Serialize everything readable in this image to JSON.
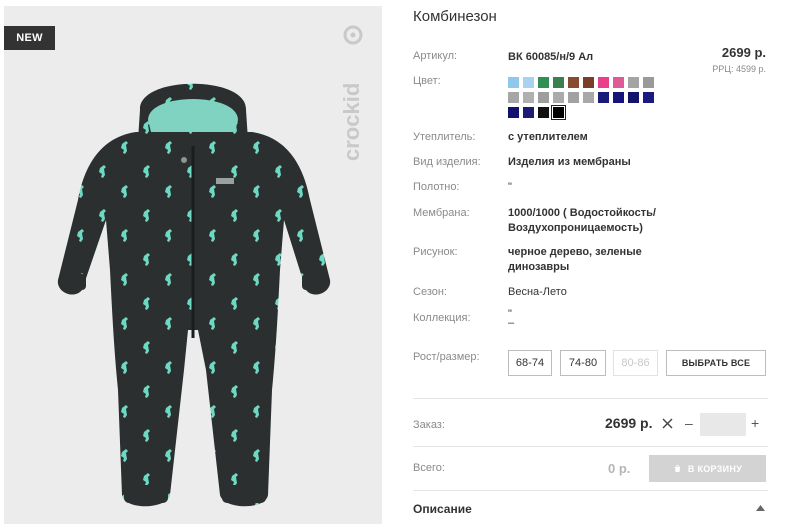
{
  "gallery": {
    "badge": "NEW",
    "brand": "crockid"
  },
  "product": {
    "title": "Комбинезон",
    "price": "2699 р.",
    "rrp": "РРЦ: 4599 р."
  },
  "specs": {
    "article_label": "Артикул:",
    "article_value": "ВК 60085/н/9 Ал",
    "color_label": "Цвет:",
    "insulation_label": "Утеплитель:",
    "insulation_value": "с утеплителем",
    "type_label": "Вид изделия:",
    "type_value": "Изделия из мембраны",
    "fabric_label": "Полотно:",
    "fabric_value": "\"",
    "membrane_label": "Мембрана:",
    "membrane_value": "1000/1000 ( Водостойкость/ Воздухопроницаемость)",
    "pattern_label": "Рисунок:",
    "pattern_value": "черное дерево, зеленые динозавры",
    "season_label": "Сезон:",
    "season_value": "Весна-Лето",
    "collection_label": "Коллекция:",
    "collection_value_1": "\"",
    "collection_value_2": "–"
  },
  "colors": [
    "#8ec8ef",
    "#a9d2f0",
    "#2f8f55",
    "#3a7f4e",
    "#8a4a2c",
    "#7a3d27",
    "#ea3e8c",
    "#e05a98",
    "#a4a4a4",
    "#9a9a9a",
    "#a6a6a6",
    "#b0b0b0",
    "#9d9d9d",
    "#ababab",
    "#a1a1a1",
    "#a8a8a8",
    "#1a1a78",
    "#14147a",
    "#111468",
    "#1a1a80",
    "#12126e",
    "#1c1c74",
    "#111111",
    "#000000"
  ],
  "selected_color_index": 23,
  "sizes": {
    "label": "Рост/размер:",
    "options": [
      {
        "label": "68-74",
        "available": true
      },
      {
        "label": "74-80",
        "available": true
      },
      {
        "label": "80-86",
        "available": false
      }
    ],
    "select_all": "ВЫБРАТЬ ВСЕ"
  },
  "order": {
    "label": "Заказ:",
    "price": "2699 р.",
    "qty_value": "",
    "minus": "–",
    "plus": "+"
  },
  "total": {
    "label": "Всего:",
    "value": "0 р.",
    "cart_button": "В КОРЗИНУ"
  },
  "description": {
    "title": "Описание"
  }
}
